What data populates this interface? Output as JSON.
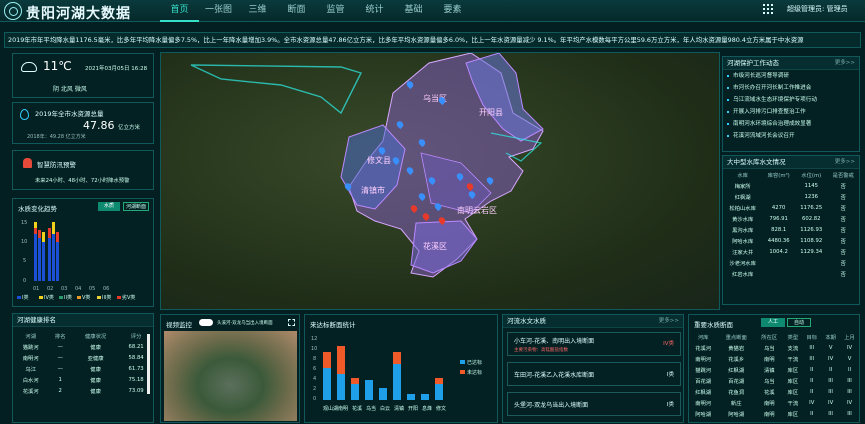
{
  "header": {
    "title": "贵阳河湖大数据",
    "nav": [
      "首页",
      "一张图",
      "三维",
      "断面",
      "监管",
      "统计",
      "基础",
      "要素"
    ],
    "user": "超级管理员: 管理员"
  },
  "ticker": "2019年市年平均降水量1176.5毫米，比多年平均降水量偏多7.5%，比上一年降水量增加3.9%。全市水资源总量47.86亿立方米，比多年平均水资源量偏多6.0%，比上一年水资源量减少 9.1%。年平均产水模数每平方公里59.6万立方米，年人均水资源量980.4立方米属于中水资源",
  "weather": {
    "temp": "11℃",
    "date": "2021年03月05日 16:28",
    "desc": "阴 北风 微风"
  },
  "water": {
    "label": "2019年全市水资源总量",
    "value": "47.86",
    "unit": "亿立方米",
    "note": "2018年：49.28 亿立方米"
  },
  "warning": {
    "title": "智慧防汛预警",
    "text": "未来24小时、48小时、72小时降水预警"
  },
  "quality": {
    "title": "水质变化趋势",
    "tabs": [
      "水质",
      "河湖断面"
    ],
    "yticks": [
      "15",
      "10",
      "5",
      "0"
    ],
    "xticks": [
      "01",
      "02",
      "03",
      "04",
      "05",
      "06"
    ],
    "legend": [
      "I类",
      "IV类",
      "II类",
      "V类",
      "III类",
      "劣V类"
    ],
    "colors": [
      "#1a4fd6",
      "#f0d21a",
      "#e83a2a"
    ]
  },
  "rank": {
    "title": "河湖健康排名",
    "cols": [
      "河湖",
      "排名",
      "健康状况",
      "评分"
    ],
    "rows": [
      [
        "猫跳河",
        "—",
        "健康",
        "68.21"
      ],
      [
        "南明河",
        "—",
        "亚健康",
        "58.84"
      ],
      [
        "乌江",
        "—",
        "健康",
        "61.73"
      ],
      [
        "白水河",
        "1",
        "健康",
        "75.18"
      ],
      [
        "花溪河",
        "2",
        "健康",
        "73.09"
      ]
    ]
  },
  "video": {
    "title": "视频监控",
    "caption": "头溪河-双龙乌当出入境断面"
  },
  "area": {
    "title": "来达标断面统计",
    "yticks": [
      "12",
      "10",
      "8",
      "6",
      "4",
      "2",
      "0"
    ],
    "categories": [
      "观山湖",
      "南明",
      "花溪",
      "乌当",
      "白云",
      "清镇",
      "开阳",
      "息烽",
      "修文"
    ],
    "legend": [
      "已达标",
      "未达标"
    ]
  },
  "river": {
    "title": "河流水文水质",
    "more": "更多>>",
    "items": [
      {
        "t": "小车河-花溪、南明出入境断面",
        "a": "主要污染物：高锰酸盐指数",
        "b": "IV类"
      },
      {
        "t": "车田河-花溪乙入花溪水库断面",
        "b": "I类"
      },
      {
        "t": "头堡河-双龙乌当出入境断面",
        "b": "I类"
      }
    ]
  },
  "protect": {
    "title": "河湖保护工作动态",
    "more": "更多>>",
    "items": [
      "市级河长巡河督导调研",
      "市河长办召开河长制工作推进会",
      "乌江流域水生态环境保护专项行动",
      "开展入河排污口排查整治工作",
      "南明河水环境综合治理成效显著",
      "花溪河流域河长会议召开",
      "市水务管理局组织开展水资源调研",
      "百里花溪景观提升工程完工"
    ]
  },
  "reservoir": {
    "title": "大中型水库水文情况",
    "more": "更多>>",
    "cols": [
      "水库",
      "库容(m³)",
      "水位(m)",
      "是否警戒"
    ],
    "rows": [
      [
        "梅家所",
        "",
        "1145",
        "否"
      ],
      [
        "红枫湖",
        "",
        "1236",
        "否"
      ],
      [
        "松柏山水库",
        "4270",
        "1176.25",
        "否"
      ],
      [
        "黄沙水库",
        "796.91",
        "602.82",
        "否"
      ],
      [
        "黑沟水库",
        "828.1",
        "1126.93",
        "否"
      ],
      [
        "阿哈水库",
        "4480.36",
        "1108.92",
        "否"
      ],
      [
        "汪家大井",
        "1004.2",
        "1129.34",
        "否"
      ],
      [
        "沙老河水库",
        "",
        "",
        "否"
      ],
      [
        "红岩水库",
        "",
        "",
        "否"
      ]
    ]
  },
  "section": {
    "title": "重要水质断面",
    "tabs": [
      "人工",
      "自动"
    ],
    "cols": [
      "河库",
      "重点断面",
      "所在区",
      "类型",
      "目标",
      "本期",
      "上月"
    ],
    "rows": [
      [
        "花溪河",
        "黄猫岩",
        "乌当",
        "支流",
        "III",
        "V",
        "IV"
      ],
      [
        "南明河",
        "花溪乡",
        "南明",
        "干流",
        "III",
        "IV",
        "V"
      ],
      [
        "猫跳河",
        "红枫湖",
        "清镇",
        "库区",
        "II",
        "II",
        "II"
      ],
      [
        "百花湖",
        "百花湖",
        "乌当",
        "库区",
        "II",
        "III",
        "III"
      ],
      [
        "红枫湖",
        "花鱼洞",
        "花溪",
        "库区",
        "II",
        "III",
        "III"
      ],
      [
        "南明河",
        "新庄",
        "南明",
        "干流",
        "IV",
        "IV",
        "IV"
      ],
      [
        "阿哈湖",
        "阿哈湖",
        "南明",
        "库区",
        "II",
        "III",
        "III"
      ]
    ]
  },
  "map": {
    "districts": [
      "乌当区",
      "开阳县",
      "修文县",
      "清镇市",
      "花溪区",
      "南明云岩区"
    ]
  }
}
